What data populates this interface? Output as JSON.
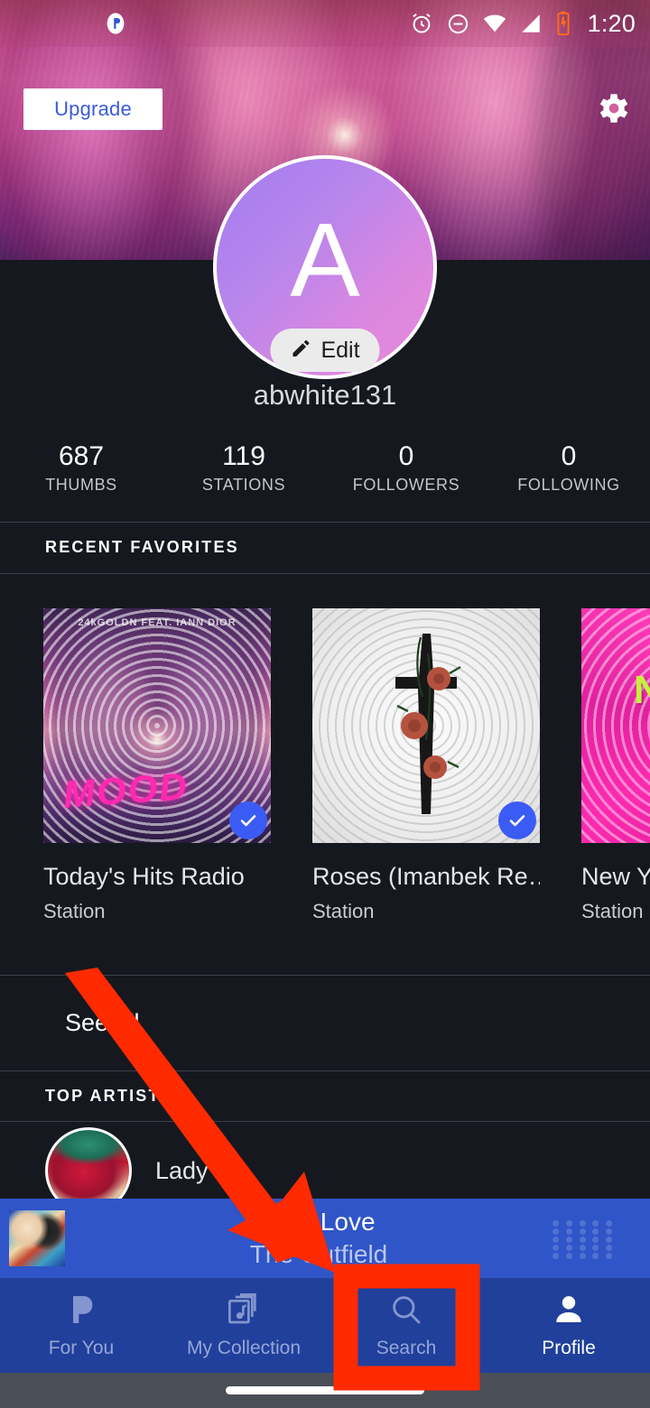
{
  "status_bar": {
    "app_icon": "pandora-icon",
    "icons": [
      "alarm-icon",
      "do-not-disturb-icon",
      "wifi-icon",
      "cellular-signal-icon",
      "battery-charging-icon"
    ],
    "time": "1:20"
  },
  "header": {
    "upgrade_label": "Upgrade",
    "settings_icon": "gear-icon",
    "banner_alt": "artist-banner-photo"
  },
  "profile": {
    "avatar_letter": "A",
    "edit_label": "Edit",
    "edit_icon": "pencil-icon",
    "username": "abwhite131",
    "stats": [
      {
        "value": "687",
        "label": "THUMBS"
      },
      {
        "value": "119",
        "label": "STATIONS"
      },
      {
        "value": "0",
        "label": "FOLLOWERS"
      },
      {
        "value": "0",
        "label": "FOLLOWING"
      }
    ]
  },
  "recent_favorites": {
    "section_title": "RECENT FAVORITES",
    "see_all_label": "See all",
    "items": [
      {
        "title": "Today's Hits Radio",
        "subtitle": "Station",
        "badge": "verified-check-icon",
        "art_caption": "MOOD",
        "art_credit": "24kGOLDN FEAT. IANN DIOR"
      },
      {
        "title": "Roses (Imanbek Re…",
        "subtitle": "Station",
        "badge": "verified-check-icon",
        "art_caption": "",
        "art_credit": ""
      },
      {
        "title": "New Yo",
        "subtitle": "Station",
        "badge": "",
        "art_caption": "NYP",
        "art_credit": ""
      }
    ]
  },
  "top_artists": {
    "section_title": "TOP ARTISTS",
    "items": [
      {
        "name": "Lady G"
      }
    ]
  },
  "now_playing": {
    "track": "Your Love",
    "artist": "The Outfield",
    "cover_alt": "album-art-play-deep",
    "queue_icon": "dot-grid-icon"
  },
  "bottom_nav": {
    "tabs": [
      {
        "label": "For You",
        "icon": "pandora-p-icon",
        "active": false
      },
      {
        "label": "My Collection",
        "icon": "collection-music-icon",
        "active": false
      },
      {
        "label": "Search",
        "icon": "search-icon",
        "active": false
      },
      {
        "label": "Profile",
        "icon": "person-icon",
        "active": true
      }
    ]
  },
  "annotations": {
    "highlight_color": "#FF2A00",
    "arrow_target": "search-tab",
    "highlight_target": "search-tab"
  },
  "colors": {
    "background": "#16181f",
    "player_bar": "#2f55c8",
    "nav_bar": "#21409b",
    "accent_blue": "#3b5bf5",
    "upgrade_text": "#3b5bdb",
    "annotation_red": "#FF2A00"
  }
}
